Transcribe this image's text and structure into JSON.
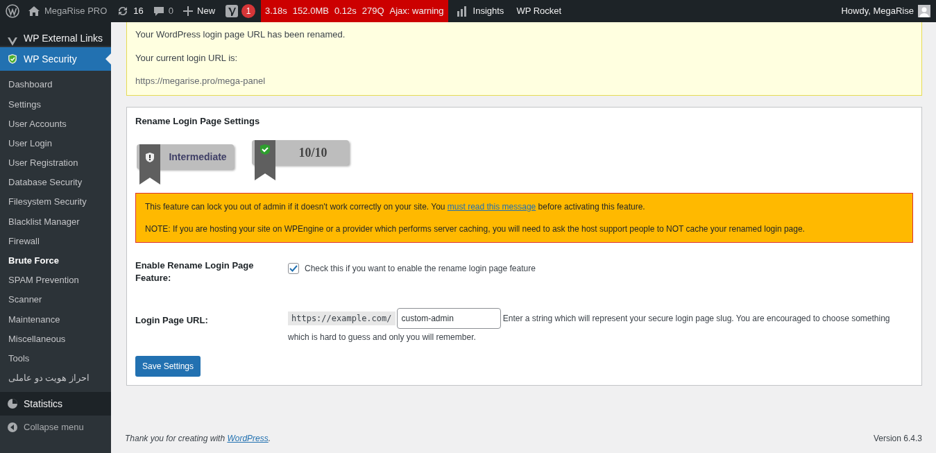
{
  "admin_bar": {
    "site_name": "MegaRise PRO",
    "updates": "16",
    "comments": "0",
    "new_label": "New",
    "yoast_count": "1",
    "query_monitor": [
      "3.18s",
      "152.0MB",
      "0.12s",
      "279Q",
      "Ajax: warning"
    ],
    "insights": "Insights",
    "wp_rocket": "WP Rocket",
    "howdy": "Howdy, MegaRise"
  },
  "sidebar": {
    "items": [
      {
        "label": "WP External Links",
        "kind": "top",
        "selected": false
      },
      {
        "label": "WP Security",
        "kind": "top",
        "selected": true
      },
      {
        "label": "Dashboard",
        "kind": "sub",
        "selected": false
      },
      {
        "label": "Settings",
        "kind": "sub",
        "selected": false
      },
      {
        "label": "User Accounts",
        "kind": "sub",
        "selected": false
      },
      {
        "label": "User Login",
        "kind": "sub",
        "selected": false
      },
      {
        "label": "User Registration",
        "kind": "sub",
        "selected": false
      },
      {
        "label": "Database Security",
        "kind": "sub",
        "selected": false
      },
      {
        "label": "Filesystem Security",
        "kind": "sub",
        "selected": false
      },
      {
        "label": "Blacklist Manager",
        "kind": "sub",
        "selected": false
      },
      {
        "label": "Firewall",
        "kind": "sub",
        "selected": false
      },
      {
        "label": "Brute Force",
        "kind": "sub",
        "selected": true
      },
      {
        "label": "SPAM Prevention",
        "kind": "sub",
        "selected": false
      },
      {
        "label": "Scanner",
        "kind": "sub",
        "selected": false
      },
      {
        "label": "Maintenance",
        "kind": "sub",
        "selected": false
      },
      {
        "label": "Miscellaneous",
        "kind": "sub",
        "selected": false
      },
      {
        "label": "Tools",
        "kind": "sub",
        "selected": false
      },
      {
        "label": "احراز هویت دو عاملی",
        "kind": "sub",
        "selected": false
      },
      {
        "label": "Statistics",
        "kind": "top",
        "selected": false
      },
      {
        "label": "Collapse menu",
        "kind": "collapse"
      }
    ]
  },
  "notice": {
    "lines": [
      "Your WordPress login page URL has been renamed.",
      "Your current login URL is:",
      "https://megarise.pro/mega-panel"
    ]
  },
  "settings": {
    "title": "Rename Login Page Settings",
    "badges": [
      "Intermediate",
      "10/10"
    ],
    "warning": [
      "This feature can lock you out of admin if it doesn't work correctly on your site. You ",
      "must read this message",
      " before activating this feature.",
      "NOTE: If you are hosting your site on WPEngine or a provider which performs server caching, you will need to ask the host support people to NOT cache your renamed login page."
    ],
    "enable_label": "Enable Rename Login Page Feature:",
    "enable_checked": true,
    "enable_text": "Check this if you want to enable the rename login page feature",
    "url_label": "Login Page URL:",
    "url_prefix": "https://example.com/",
    "url_value": "custom-admin",
    "url_help": "Enter a string which will represent your secure login page slug. You are encouraged to choose something which is hard to guess and only you will remember.",
    "save": "Save Settings"
  },
  "footer": {
    "thanks": "Thank you for creating with ",
    "link": "WordPress",
    "thanks_end": ".",
    "version": "Version 6.4.3"
  }
}
